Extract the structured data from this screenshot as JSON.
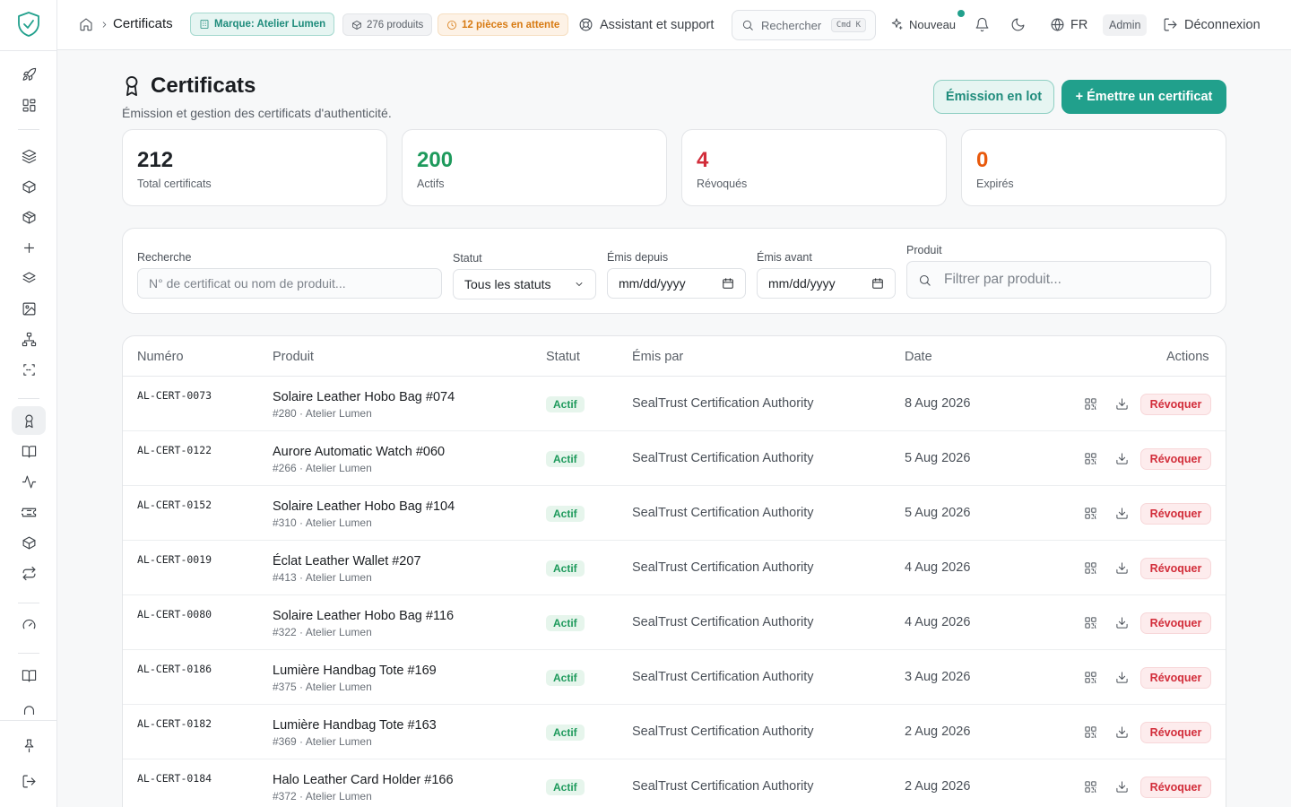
{
  "topbar": {
    "breadcrumb": "Certificats",
    "brand_pill": "Marque: Atelier Lumen",
    "products_pill": "276 produits",
    "pending_pill": "12 pièces en attente",
    "support": "Assistant et support",
    "search_placeholder": "Rechercher",
    "search_shortcut": "Cmd K",
    "new_label": "Nouveau",
    "language": "FR",
    "role": "Admin",
    "logout": "Déconnexion"
  },
  "header": {
    "title": "Certificats",
    "subtitle": "Émission et gestion des certificats d'authenticité.",
    "batch_button": "Émission en lot",
    "issue_button": "+ Émettre un certificat"
  },
  "stats": [
    {
      "value": "212",
      "label": "Total certificats",
      "color": "#1a1d21"
    },
    {
      "value": "200",
      "label": "Actifs",
      "color": "#1e9a5c"
    },
    {
      "value": "4",
      "label": "Révoqués",
      "color": "#d22d3a"
    },
    {
      "value": "0",
      "label": "Expirés",
      "color": "#e8590c"
    }
  ],
  "filters": {
    "search_label": "Recherche",
    "search_placeholder": "N° de certificat ou nom de produit...",
    "status_label": "Statut",
    "status_value": "Tous les statuts",
    "from_label": "Émis depuis",
    "from_value": "mm/dd/yyyy",
    "to_label": "Émis avant",
    "to_value": "mm/dd/yyyy",
    "product_label": "Produit",
    "product_placeholder": "Filtrer par produit..."
  },
  "table": {
    "headers": {
      "number": "Numéro",
      "product": "Produit",
      "status": "Statut",
      "issuer": "Émis par",
      "date": "Date",
      "actions": "Actions"
    },
    "revoke_label": "Révoquer",
    "rows": [
      {
        "number": "AL-CERT-0073",
        "product": "Solaire Leather Hobo Bag #074",
        "meta": "#280  ·  Atelier Lumen",
        "status": "Actif",
        "issuer": "SealTrust Certification Authority",
        "date": "8 Aug 2026"
      },
      {
        "number": "AL-CERT-0122",
        "product": "Aurore Automatic Watch #060",
        "meta": "#266  ·  Atelier Lumen",
        "status": "Actif",
        "issuer": "SealTrust Certification Authority",
        "date": "5 Aug 2026"
      },
      {
        "number": "AL-CERT-0152",
        "product": "Solaire Leather Hobo Bag #104",
        "meta": "#310  ·  Atelier Lumen",
        "status": "Actif",
        "issuer": "SealTrust Certification Authority",
        "date": "5 Aug 2026"
      },
      {
        "number": "AL-CERT-0019",
        "product": "Éclat Leather Wallet #207",
        "meta": "#413  ·  Atelier Lumen",
        "status": "Actif",
        "issuer": "SealTrust Certification Authority",
        "date": "4 Aug 2026"
      },
      {
        "number": "AL-CERT-0080",
        "product": "Solaire Leather Hobo Bag #116",
        "meta": "#322  ·  Atelier Lumen",
        "status": "Actif",
        "issuer": "SealTrust Certification Authority",
        "date": "4 Aug 2026"
      },
      {
        "number": "AL-CERT-0186",
        "product": "Lumière Handbag Tote #169",
        "meta": "#375  ·  Atelier Lumen",
        "status": "Actif",
        "issuer": "SealTrust Certification Authority",
        "date": "3 Aug 2026"
      },
      {
        "number": "AL-CERT-0182",
        "product": "Lumière Handbag Tote #163",
        "meta": "#369  ·  Atelier Lumen",
        "status": "Actif",
        "issuer": "SealTrust Certification Authority",
        "date": "2 Aug 2026"
      },
      {
        "number": "AL-CERT-0184",
        "product": "Halo Leather Card Holder #166",
        "meta": "#372  ·  Atelier Lumen",
        "status": "Actif",
        "issuer": "SealTrust Certification Authority",
        "date": "2 Aug 2026"
      }
    ]
  },
  "sidebar": {
    "icons": [
      "rocket-icon",
      "dashboard-icon",
      "layers-icon",
      "box-icon",
      "package-icon",
      "plus-icon",
      "stack-icon",
      "image-icon",
      "hierarchy-icon",
      "scan-icon",
      "award-icon",
      "book-icon",
      "activity-icon",
      "ticket-icon",
      "cube-icon",
      "repeat-icon",
      "gauge-icon",
      "book-open-icon",
      "arch-icon",
      "pin-icon",
      "logout-icon"
    ]
  },
  "colors": {
    "accent": "#21a08c",
    "accent_light": "#e6f5f2",
    "danger": "#d22d3a",
    "success": "#1e9a5c",
    "warning": "#d77a12"
  }
}
